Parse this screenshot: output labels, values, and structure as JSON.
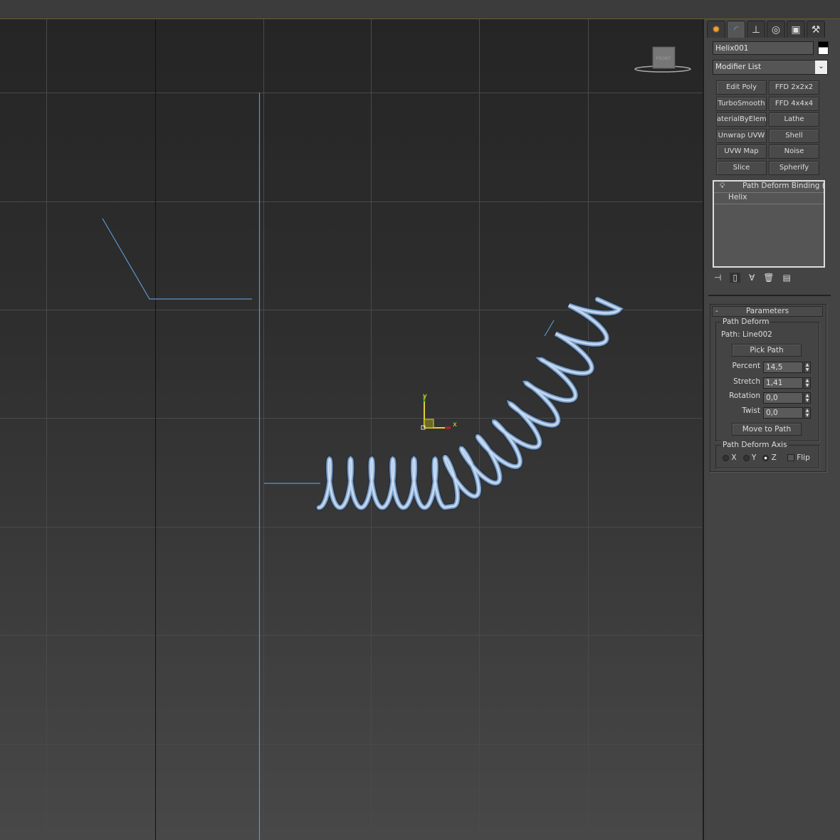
{
  "viewport": {
    "viewcube_label": "FRONT",
    "gizmo": {
      "x": "x",
      "y": "y"
    },
    "object_color": "#9ab8dd"
  },
  "panel": {
    "tabs": [
      {
        "icon": "create-icon"
      },
      {
        "icon": "modify-icon"
      },
      {
        "icon": "hierarchy-icon"
      },
      {
        "icon": "motion-icon"
      },
      {
        "icon": "display-icon"
      },
      {
        "icon": "utilities-icon"
      }
    ],
    "object_name": "Helix001",
    "modifier_list": "Modifier List",
    "modifier_buttons": [
      "Edit Poly",
      "FFD 2x2x2",
      "TurboSmooth",
      "FFD 4x4x4",
      "aterialByElemen",
      "Lathe",
      "Unwrap UVW",
      "Shell",
      "UVW Map",
      "Noise",
      "Slice",
      "Spherify"
    ],
    "stack": [
      "Path Deform Binding (WSM)",
      "Helix"
    ],
    "parameters": {
      "title": "Parameters",
      "collapse": "-",
      "group": "Path Deform",
      "path": "Path: Line002",
      "pick_path": "Pick Path",
      "percent_label": "Percent",
      "percent": "14,5",
      "stretch_label": "Stretch",
      "stretch": "1,41",
      "rotation_label": "Rotation",
      "rotation": "0,0",
      "twist_label": "Twist",
      "twist": "0,0",
      "move_to_path": "Move to Path",
      "axis_group": "Path Deform Axis",
      "axis_x": "X",
      "axis_y": "Y",
      "axis_z": "Z",
      "selected_axis": "Z",
      "flip": "Flip"
    }
  }
}
